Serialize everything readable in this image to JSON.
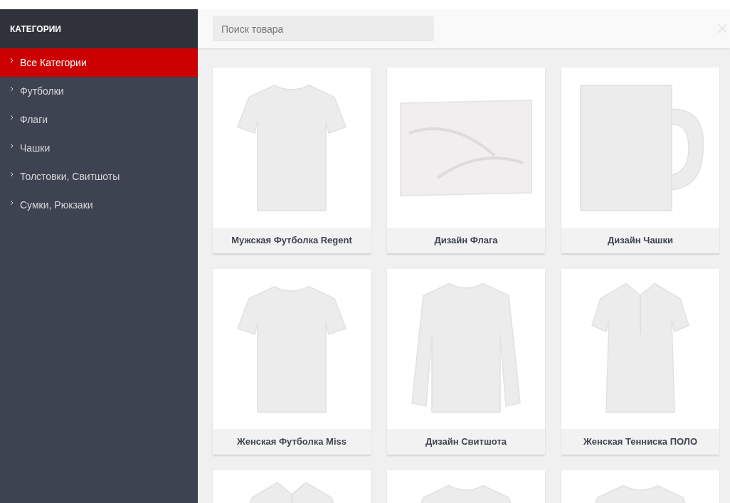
{
  "sidebar": {
    "title": "КАТЕГОРИИ",
    "items": [
      {
        "label": "Все Категории",
        "selected": true
      },
      {
        "label": "Футболки",
        "selected": false
      },
      {
        "label": "Флаги",
        "selected": false
      },
      {
        "label": "Чашки",
        "selected": false
      },
      {
        "label": "Толстовки, Свитшоты",
        "selected": false
      },
      {
        "label": "Сумки, Рюкзаки",
        "selected": false
      }
    ]
  },
  "search": {
    "placeholder": "Поиск товара"
  },
  "products": [
    {
      "kind": "tshirt",
      "title": "Мужская Футболка Regent"
    },
    {
      "kind": "flag",
      "title": "Дизайн Флага"
    },
    {
      "kind": "mug",
      "title": "Дизайн Чашки"
    },
    {
      "kind": "tshirt",
      "title": "Женская Футболка Miss"
    },
    {
      "kind": "longsleeve",
      "title": "Дизайн Свитшота"
    },
    {
      "kind": "polo",
      "title": "Женская Тенниска ПОЛО"
    },
    {
      "kind": "polo"
    },
    {
      "kind": "tshirt"
    },
    {
      "kind": "tshirt"
    }
  ]
}
